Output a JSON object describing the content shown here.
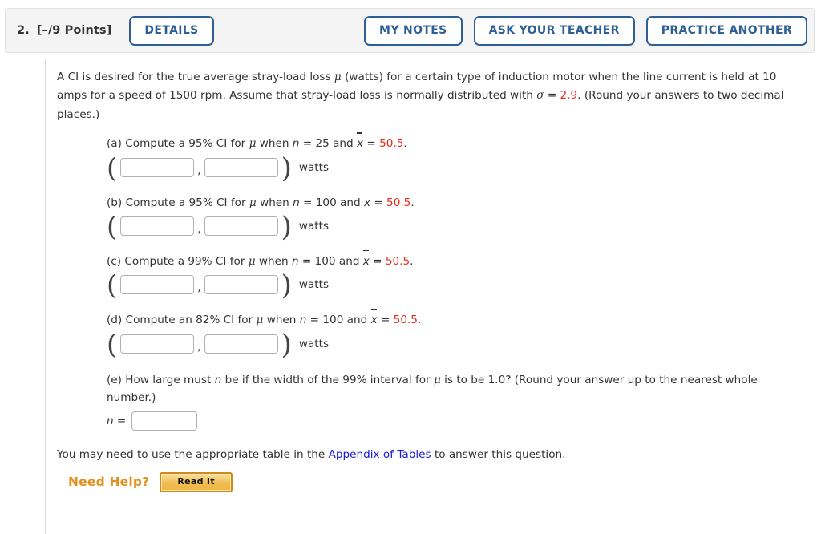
{
  "header": {
    "question_number": "2.",
    "points": "[–/9 Points]",
    "details_label": "DETAILS",
    "my_notes_label": "MY NOTES",
    "ask_your_teacher_label": "ASK YOUR TEACHER",
    "practice_another_label": "PRACTICE ANOTHER"
  },
  "stem": {
    "line1_a": "A CI is desired for the true average stray-load loss ",
    "mu": "μ",
    "line1_b": " (watts) for a certain type of induction motor when the line current is held at 10 amps for a speed of 1500 rpm. Assume that stray-load loss is normally distributed with ",
    "sigma": "σ",
    "eq": " = ",
    "sigma_value": "2.9",
    "line1_c": ". (Round your answers to two decimal places.)"
  },
  "parts": [
    {
      "id": "a",
      "label": "(a)",
      "text_before_n": " Compute a 95% CI for ",
      "mu": "μ",
      "text_when": " when ",
      "n_symbol": "n",
      "n_eq": " = ",
      "n_value": "25",
      "and": " and ",
      "xbar_symbol": "x",
      "xbar_eq": " = ",
      "xbar_value": "50.5",
      "period": ".",
      "lower_value": "",
      "upper_value": "",
      "units": "watts",
      "separator": ","
    },
    {
      "id": "b",
      "label": "(b)",
      "text_before_n": " Compute a 95% CI for ",
      "mu": "μ",
      "text_when": " when ",
      "n_symbol": "n",
      "n_eq": " = ",
      "n_value": "100",
      "and": " and ",
      "xbar_symbol": "x",
      "xbar_eq": " = ",
      "xbar_value": "50.5",
      "period": ".",
      "lower_value": "",
      "upper_value": "",
      "units": "watts",
      "separator": ","
    },
    {
      "id": "c",
      "label": "(c)",
      "text_before_n": " Compute a 99% CI for ",
      "mu": "μ",
      "text_when": " when ",
      "n_symbol": "n",
      "n_eq": " = ",
      "n_value": "100",
      "and": " and ",
      "xbar_symbol": "x",
      "xbar_eq": " = ",
      "xbar_value": "50.5",
      "period": ".",
      "lower_value": "",
      "upper_value": "",
      "units": "watts",
      "separator": ","
    },
    {
      "id": "d",
      "label": "(d)",
      "text_before_n": " Compute an 82% CI for ",
      "mu": "μ",
      "text_when": " when ",
      "n_symbol": "n",
      "n_eq": " = ",
      "n_value": "100",
      "and": " and ",
      "xbar_symbol": "x",
      "xbar_eq": " = ",
      "xbar_value": "50.5",
      "period": ".",
      "lower_value": "",
      "upper_value": "",
      "units": "watts",
      "separator": ","
    }
  ],
  "part_e": {
    "label": "(e)",
    "seg1": " How large must ",
    "n_symbol": "n",
    "seg2": " be if the width of the 99% interval for ",
    "mu": "μ",
    "seg3": " is to be 1.0? (Round your answer up to the nearest whole number.)",
    "n_label": "n =",
    "n_value": ""
  },
  "footer": {
    "note_before": "You may need to use the appropriate table in the ",
    "link_text": "Appendix of Tables",
    "note_after": " to answer this question.",
    "need_help_label": "Need Help?",
    "read_it_label": "Read It"
  },
  "colors": {
    "accent_blue": "#2d5f94",
    "value_red": "#e8291c",
    "link_blue": "#1a1ae0",
    "help_orange": "#e3901f",
    "header_bg": "#f4f4f4"
  }
}
